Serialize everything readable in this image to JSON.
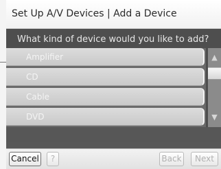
{
  "dialog": {
    "title": "Set Up A/V Devices | Add a Device",
    "question": "What kind of device would you like to add?"
  },
  "device_list": {
    "items": [
      {
        "label": "Amplifier"
      },
      {
        "label": "CD"
      },
      {
        "label": "Cable"
      },
      {
        "label": "DVD"
      }
    ],
    "scroll_up_icon": "triangle-up",
    "scroll_down_icon": "triangle-down"
  },
  "footer": {
    "cancel_label": "Cancel",
    "help_label": "?",
    "back_label": "Back",
    "next_label": "Next"
  },
  "colors": {
    "dialog_bg": "#4e4e4e",
    "list_item": "#d4d4d4",
    "list_text": "#f4f4f4",
    "disabled_text": "#b0b0b0"
  }
}
